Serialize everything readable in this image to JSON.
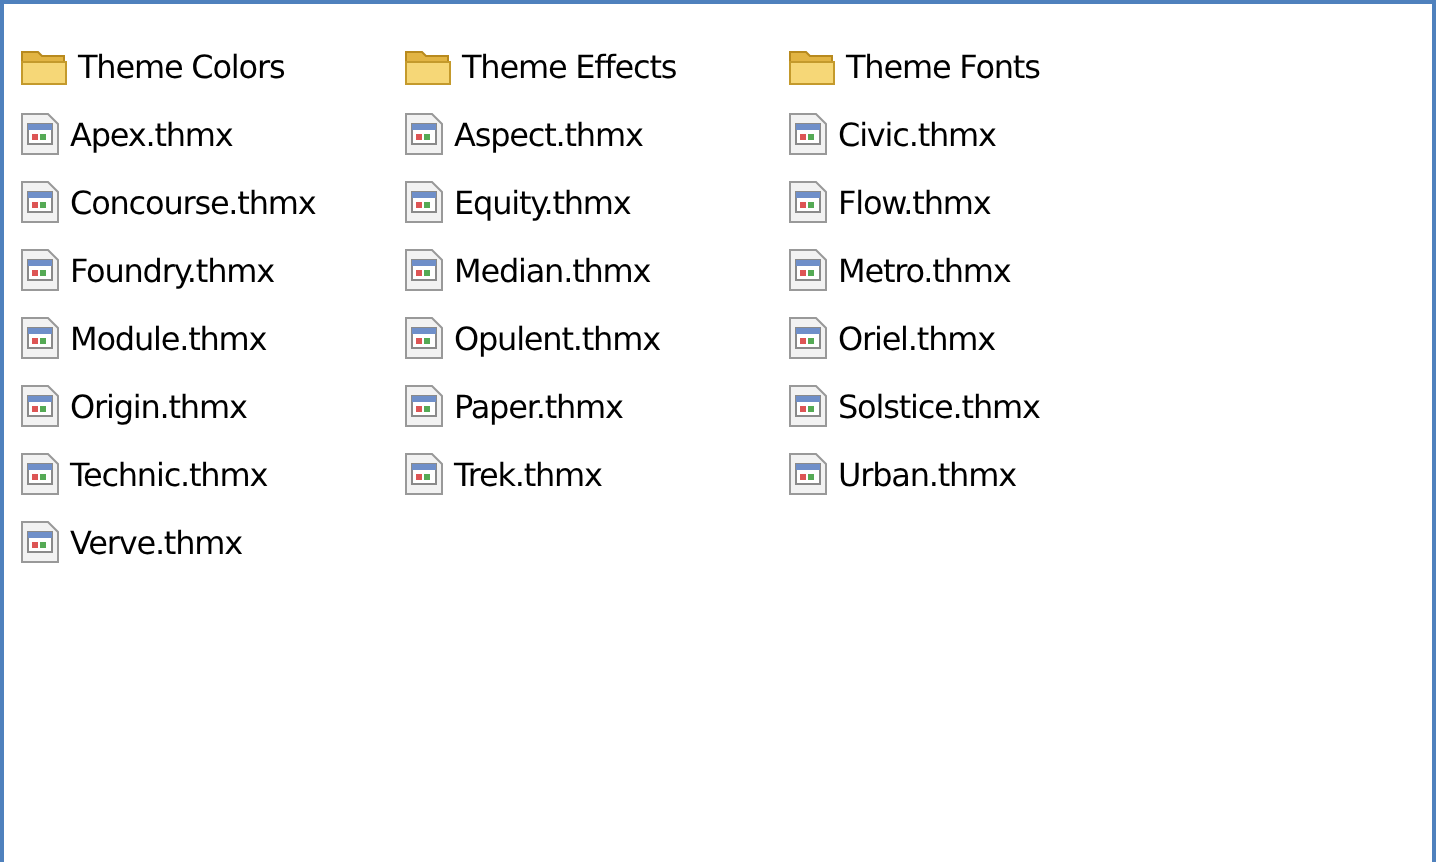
{
  "items": [
    {
      "kind": "folder",
      "name": "Theme Colors"
    },
    {
      "kind": "folder",
      "name": "Theme Effects"
    },
    {
      "kind": "folder",
      "name": "Theme Fonts"
    },
    {
      "kind": "file",
      "name": "Apex.thmx"
    },
    {
      "kind": "file",
      "name": "Aspect.thmx"
    },
    {
      "kind": "file",
      "name": "Civic.thmx"
    },
    {
      "kind": "file",
      "name": "Concourse.thmx"
    },
    {
      "kind": "file",
      "name": "Equity.thmx"
    },
    {
      "kind": "file",
      "name": "Flow.thmx"
    },
    {
      "kind": "file",
      "name": "Foundry.thmx"
    },
    {
      "kind": "file",
      "name": "Median.thmx"
    },
    {
      "kind": "file",
      "name": "Metro.thmx"
    },
    {
      "kind": "file",
      "name": "Module.thmx"
    },
    {
      "kind": "file",
      "name": "Opulent.thmx"
    },
    {
      "kind": "file",
      "name": "Oriel.thmx"
    },
    {
      "kind": "file",
      "name": "Origin.thmx"
    },
    {
      "kind": "file",
      "name": "Paper.thmx"
    },
    {
      "kind": "file",
      "name": "Solstice.thmx"
    },
    {
      "kind": "file",
      "name": "Technic.thmx"
    },
    {
      "kind": "file",
      "name": "Trek.thmx"
    },
    {
      "kind": "file",
      "name": "Urban.thmx"
    },
    {
      "kind": "file",
      "name": "Verve.thmx"
    }
  ]
}
